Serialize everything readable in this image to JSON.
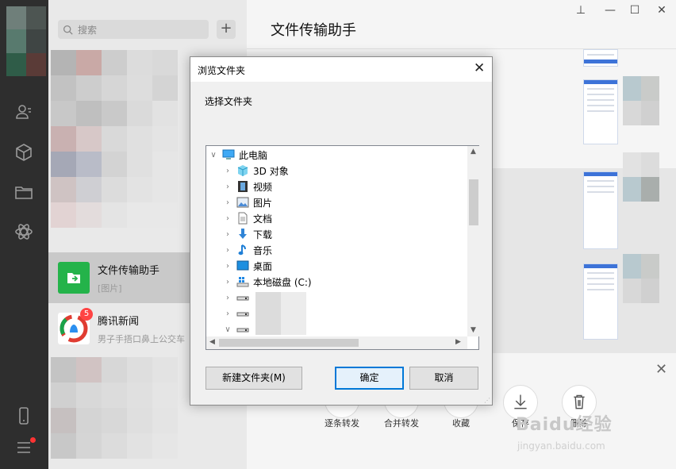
{
  "search": {
    "placeholder": "搜索"
  },
  "list_add_label": "+",
  "chats": [
    {
      "name": "文件传输助手",
      "subtitle": "[图片]"
    },
    {
      "name": "腾讯新闻",
      "subtitle": "男子手捂口鼻上公交车",
      "badge": "5"
    }
  ],
  "main_title": "文件传输助手",
  "window_controls": {
    "pin": "⊥",
    "minimize": "—",
    "maximize": "☐",
    "close": "✕"
  },
  "actions": [
    "逐条转发",
    "合并转发",
    "收藏",
    "保存",
    "删除"
  ],
  "action_close": "✕",
  "watermark": {
    "brand": "Baidu经验",
    "url": "jingyan.baidu.com"
  },
  "dialog": {
    "title": "浏览文件夹",
    "close": "✕",
    "label": "选择文件夹",
    "tree": [
      {
        "label": "此电脑",
        "icon": "computer-icon",
        "expanded": true
      },
      {
        "label": "3D 对象",
        "icon": "cube-3d-icon"
      },
      {
        "label": "视频",
        "icon": "video-icon"
      },
      {
        "label": "图片",
        "icon": "picture-icon"
      },
      {
        "label": "文档",
        "icon": "document-icon"
      },
      {
        "label": "下载",
        "icon": "download-icon"
      },
      {
        "label": "音乐",
        "icon": "music-icon"
      },
      {
        "label": "桌面",
        "icon": "desktop-icon"
      },
      {
        "label": "本地磁盘 (C:)",
        "icon": "windows-drive-icon"
      },
      {
        "label": "",
        "icon": "drive-icon"
      },
      {
        "label": "",
        "icon": "drive-icon"
      },
      {
        "label": "",
        "icon": "drive-icon",
        "expanded": true
      }
    ],
    "new_folder": "新建文件夹(M)",
    "ok": "确定",
    "cancel": "取消"
  }
}
